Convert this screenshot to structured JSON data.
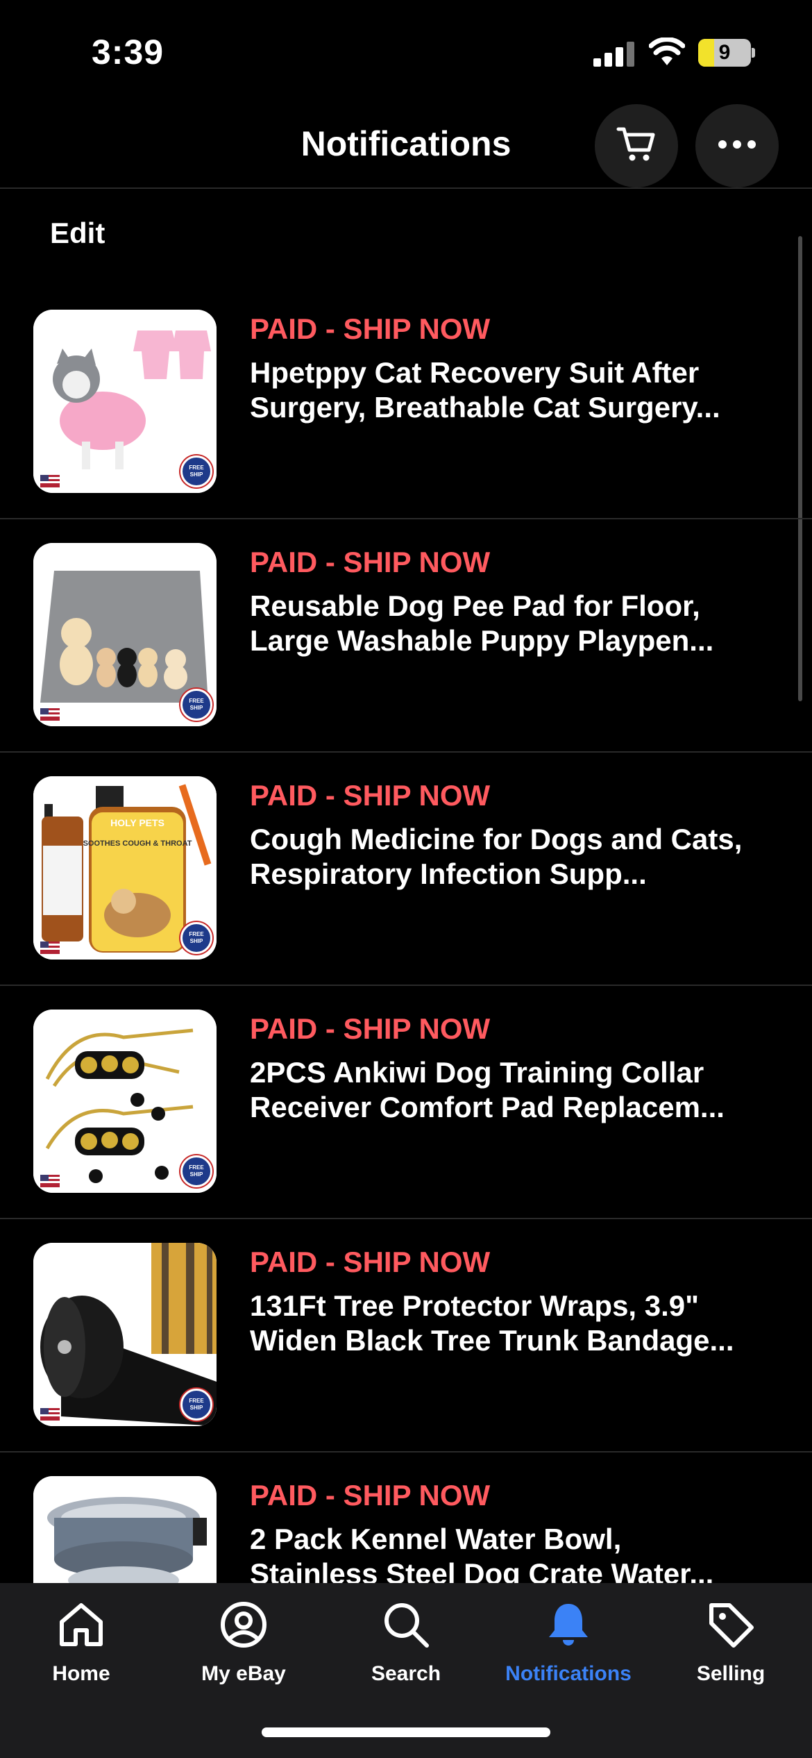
{
  "status_bar": {
    "time": "3:39",
    "battery_level": "9",
    "battery_fraction": 0.3
  },
  "header": {
    "title": "Notifications",
    "cart_icon": "cart-icon",
    "more_icon": "more-horizontal-icon"
  },
  "edit_label": "Edit",
  "notifications": [
    {
      "status": "PAID - SHIP NOW",
      "title": "Hpetppy Cat Recovery Suit After Surgery, Breathable Cat Surgery...",
      "thumb": "pink-cat-recovery-suit"
    },
    {
      "status": "PAID - SHIP NOW",
      "title": "Reusable Dog Pee Pad for Floor, Large Washable Puppy Playpen...",
      "thumb": "grey-pee-pad-with-dogs"
    },
    {
      "status": "PAID - SHIP NOW",
      "title": "Cough Medicine for Dogs and Cats, Respiratory Infection Supp...",
      "thumb": "holy-pets-bottle"
    },
    {
      "status": "PAID - SHIP NOW",
      "title": "2PCS Ankiwi Dog Training Collar Receiver Comfort Pad Replacem...",
      "thumb": "collar-pads"
    },
    {
      "status": "PAID - SHIP NOW",
      "title": "131Ft Tree Protector Wraps, 3.9\" Widen Black Tree Trunk Bandage...",
      "thumb": "black-tree-wrap"
    },
    {
      "status": "PAID - SHIP NOW",
      "title": "2 Pack Kennel Water Bowl, Stainless Steel Dog Crate Water...",
      "thumb": "kennel-bowls"
    }
  ],
  "thumb_text": {
    "holy_pets": "HOLY PETS",
    "soothes": "SOOTHES COUGH & THROAT"
  },
  "tabs": [
    {
      "label": "Home",
      "icon": "home-icon"
    },
    {
      "label": "My eBay",
      "icon": "user-circle-icon"
    },
    {
      "label": "Search",
      "icon": "search-icon"
    },
    {
      "label": "Notifications",
      "icon": "bell-icon",
      "active": true
    },
    {
      "label": "Selling",
      "icon": "tag-icon"
    }
  ],
  "colors": {
    "status_red": "#ff5a5f",
    "active_blue": "#3b82f6",
    "background": "#000000"
  }
}
